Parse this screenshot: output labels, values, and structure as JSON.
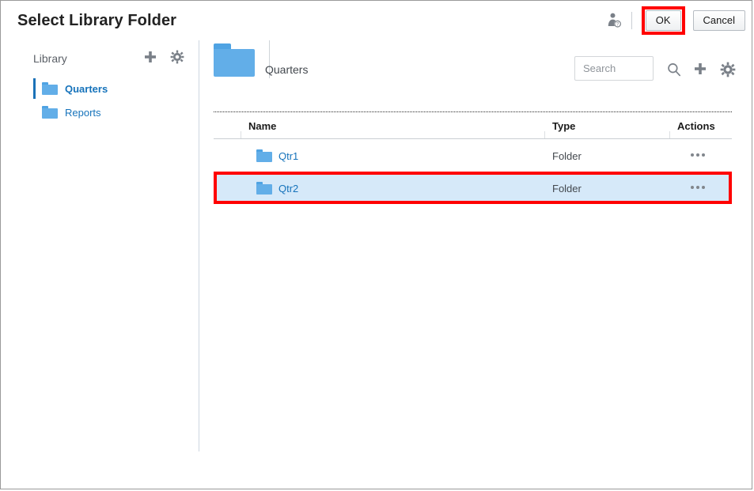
{
  "dialog": {
    "title": "Select Library Folder",
    "user_help_icon": "user-help-icon",
    "ok_label": "OK",
    "cancel_label": "Cancel",
    "highlight_color": "#ff0000"
  },
  "sidebar": {
    "title": "Library",
    "add_icon": "plus-icon",
    "settings_icon": "gear-icon",
    "items": [
      {
        "label": "Quarters",
        "icon": "folder-icon",
        "selected": true
      },
      {
        "label": "Reports",
        "icon": "folder-icon",
        "selected": false
      }
    ]
  },
  "content": {
    "folder_icon": "folder-icon",
    "folder_name": "Quarters",
    "search": {
      "placeholder": "Search",
      "value": ""
    },
    "search_icon": "search-icon",
    "add_icon": "plus-icon",
    "settings_icon": "gear-icon",
    "table": {
      "columns": [
        "Name",
        "Type",
        "Actions"
      ],
      "rows": [
        {
          "name": "Qtr1",
          "type": "Folder",
          "icon": "folder-icon",
          "actions_icon": "ellipsis-icon",
          "selected": false
        },
        {
          "name": "Qtr2",
          "type": "Folder",
          "icon": "folder-icon",
          "actions_icon": "ellipsis-icon",
          "selected": true
        }
      ]
    }
  },
  "colors": {
    "link": "#1673bb",
    "folder": "#62aee8",
    "selected_row_bg": "#d6e9f9",
    "highlight": "#ff0000"
  }
}
